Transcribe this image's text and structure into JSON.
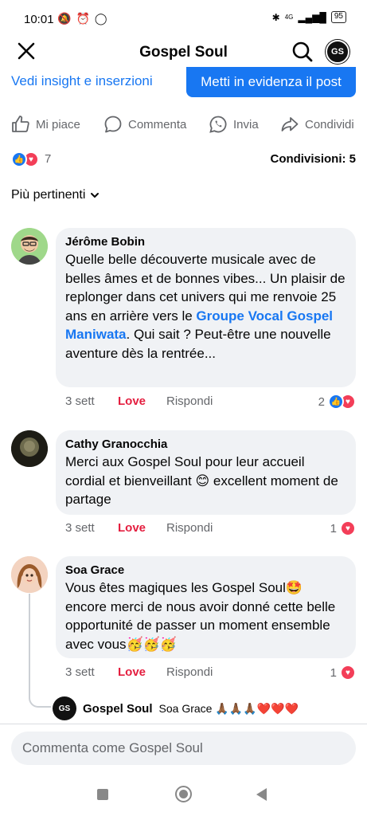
{
  "status_bar": {
    "time": "10:01",
    "network": "4G",
    "battery": "95"
  },
  "header": {
    "title": "Gospel Soul",
    "avatar_initials": "GS"
  },
  "insights": {
    "link_label": "Vedi insight e inserzioni",
    "boost_label": "Metti in evidenza il post"
  },
  "actions": {
    "like": "Mi piace",
    "comment": "Commenta",
    "send": "Invia",
    "share": "Condividi"
  },
  "post_stats": {
    "reactions": "7",
    "shares": "Condivisioni: 5"
  },
  "sort": {
    "label": "Più pertinenti"
  },
  "comments": [
    {
      "author": "Jérôme Bobin",
      "text_before": "Quelle belle découverte musicale avec de belles âmes et de bonnes vibes... Un plaisir de replonger dans cet univers qui me renvoie 25 ans en arrière vers le ",
      "mention": "Groupe Vocal Gospel Maniwata",
      "text_after": ". Qui sait ? Peut-être une nouvelle aventure dès la rentrée...",
      "time": "3 sett",
      "love": "Love",
      "reply": "Rispondi",
      "reaction_count": "2"
    },
    {
      "author": "Cathy Granocchia",
      "text": "Merci aux Gospel Soul pour leur accueil cordial et bienveillant 😊 excellent moment de partage",
      "time": "3 sett",
      "love": "Love",
      "reply": "Rispondi",
      "reaction_count": "1"
    },
    {
      "author": "Soa Grace",
      "text": "Vous êtes magiques les Gospel Soul🤩 encore merci de nous avoir donné cette belle opportunité de passer un moment ensemble avec vous🥳🥳🥳",
      "time": "3 sett",
      "love": "Love",
      "reply": "Rispondi",
      "reaction_count": "1"
    }
  ],
  "reply": {
    "author": "Gospel Soul",
    "text": "Soa Grace 🙏🏾🙏🏾🙏🏾❤️❤️❤️",
    "avatar_initials": "GS"
  },
  "composer": {
    "placeholder": "Commenta come Gospel Soul"
  },
  "colors": {
    "accent": "#1877f2",
    "love": "#e41e3f",
    "bubble": "#f0f2f5",
    "muted": "#65676b"
  }
}
